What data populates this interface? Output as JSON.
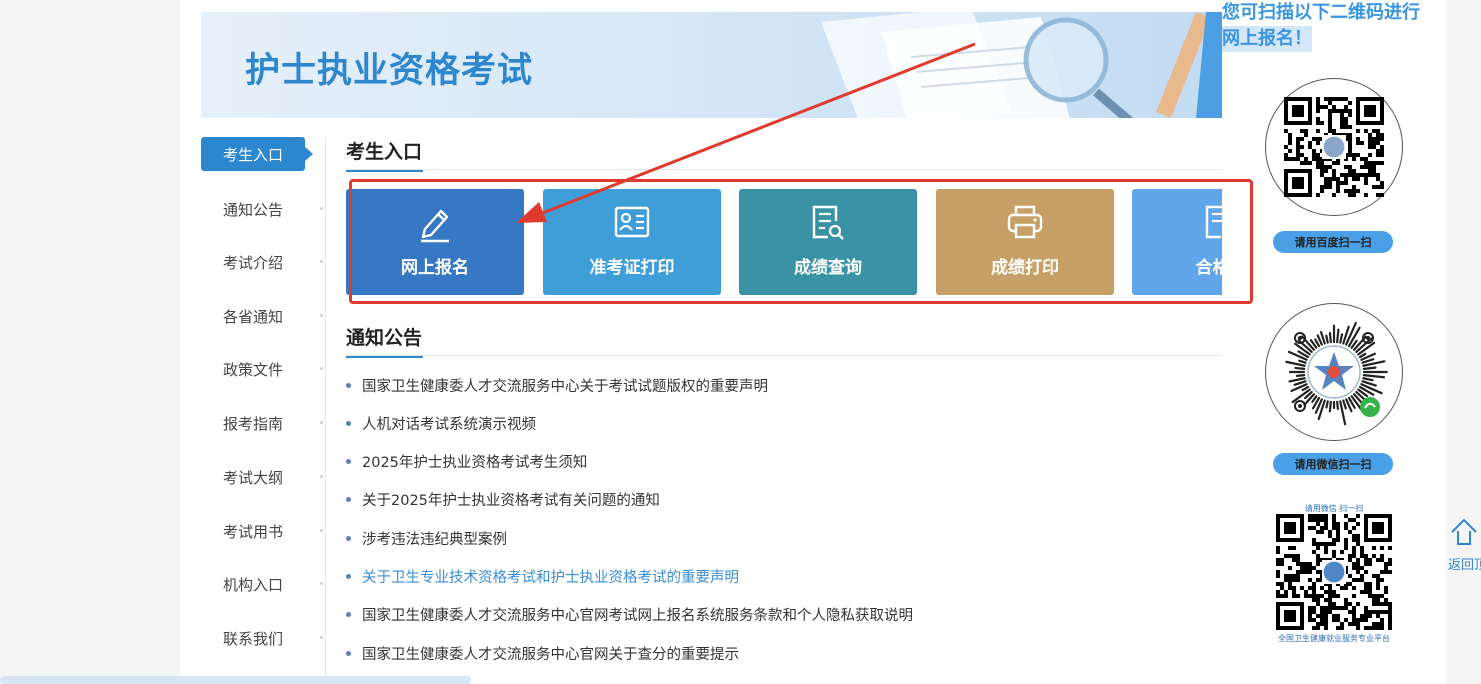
{
  "banner": {
    "title": "护士执业资格考试"
  },
  "sidebar": {
    "items": [
      {
        "label": "考生入口",
        "active": true
      },
      {
        "label": "通知公告"
      },
      {
        "label": "考试介绍"
      },
      {
        "label": "各省通知"
      },
      {
        "label": "政策文件"
      },
      {
        "label": "报考指南"
      },
      {
        "label": "考试大纲"
      },
      {
        "label": "考试用书"
      },
      {
        "label": "机构入口"
      },
      {
        "label": "联系我们"
      }
    ]
  },
  "entry_section": {
    "title": "考生入口",
    "tiles": [
      {
        "label": "网上报名",
        "icon": "pen-icon",
        "color": "#3678c4"
      },
      {
        "label": "准考证打印",
        "icon": "id-card-icon",
        "color": "#3f9dd8"
      },
      {
        "label": "成绩查询",
        "icon": "document-search-icon",
        "color": "#3a93a4"
      },
      {
        "label": "成绩打印",
        "icon": "printer-icon",
        "color": "#c6a067"
      },
      {
        "label": "合格证",
        "icon": "certificate-icon",
        "color": "#61a5ea"
      }
    ]
  },
  "notice_section": {
    "title": "通知公告",
    "items": [
      {
        "text": "国家卫生健康委人才交流服务中心关于考试试题版权的重要声明"
      },
      {
        "text": "人机对话考试系统演示视频"
      },
      {
        "text": "2025年护士执业资格考试考生须知"
      },
      {
        "text": "关于2025年护士执业资格考试有关问题的通知"
      },
      {
        "text": "涉考违法违纪典型案例"
      },
      {
        "text": "关于卫生专业技术资格考试和护士执业资格考试的重要声明",
        "highlight": true
      },
      {
        "text": "国家卫生健康委人才交流服务中心官网考试网上报名系统服务条款和个人隐私获取说明"
      },
      {
        "text": "国家卫生健康委人才交流服务中心官网关于查分的重要提示"
      }
    ]
  },
  "qr_panel": {
    "heading_line1": "您可扫描以下二维码进行",
    "heading_line2": "网上报名！",
    "baidu_button": "请用百度扫一扫",
    "wechat_button": "请用微信扫一扫",
    "third_caption_top": "请用微信 扫一扫",
    "third_caption_bottom": "全国卫生健康就业服务专业平台"
  },
  "back_to_top": {
    "label": "返回顶部"
  },
  "colors": {
    "accent": "#2d87cf",
    "annotation": "#e03a2f"
  }
}
